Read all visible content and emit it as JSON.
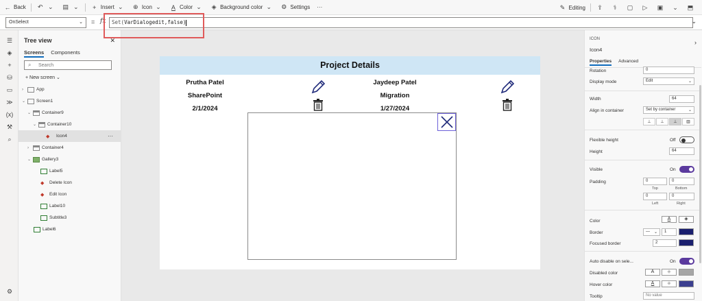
{
  "toolbar": {
    "back_label": "Back",
    "insert_label": "Insert",
    "icon_label": "Icon",
    "color_label": "Color",
    "background_label": "Background color",
    "settings_label": "Settings",
    "more_label": "···",
    "editing_label": "Editing"
  },
  "formula_bar": {
    "property": "OnSelect",
    "equals": "=",
    "fx": "fx",
    "formula_prefix": "Set(",
    "formula_var": "VarDialogedit,false)"
  },
  "tree": {
    "title": "Tree view",
    "tabs": [
      "Screens",
      "Components"
    ],
    "search_placeholder": "Search",
    "new_screen": "+ New screen",
    "nodes": [
      {
        "label": "App"
      },
      {
        "label": "Screen1"
      },
      {
        "label": "Container9"
      },
      {
        "label": "Container10"
      },
      {
        "label": "Icon4"
      },
      {
        "label": "Container4"
      },
      {
        "label": "Gallery3"
      },
      {
        "label": "Label5"
      },
      {
        "label": "Delete Icon"
      },
      {
        "label": "Edit Icon"
      },
      {
        "label": "Label10"
      },
      {
        "label": "Subtitle3"
      },
      {
        "label": "Label6"
      }
    ]
  },
  "canvas": {
    "title": "Project Details",
    "cards": [
      {
        "name": "Prutha Patel",
        "project": "SharePoint",
        "date": "2/1/2024"
      },
      {
        "name": "Jaydeep Patel",
        "project": "Migration",
        "date": "1/27/2024"
      }
    ]
  },
  "properties": {
    "type": "ICON",
    "name": "Icon4",
    "tabs": [
      "Properties",
      "Advanced"
    ],
    "rotation_label": "Rotation",
    "rotation_value": "0",
    "display_mode_label": "Display mode",
    "display_mode_value": "Edit",
    "width_label": "Width",
    "width_value": "64",
    "align_label": "Align in container",
    "align_value": "Set by container",
    "flexible_height_label": "Flexible height",
    "flexible_height_state": "Off",
    "height_label": "Height",
    "height_value": "64",
    "visible_label": "Visible",
    "visible_state": "On",
    "padding_label": "Padding",
    "padding_top": "0",
    "padding_bottom": "0",
    "padding_left": "0",
    "padding_right": "0",
    "pad_top_label": "Top",
    "pad_bottom_label": "Bottom",
    "pad_left_label": "Left",
    "pad_right_label": "Right",
    "color_label": "Color",
    "border_label": "Border",
    "border_value": "1",
    "focused_border_label": "Focused border",
    "focused_border_value": "2",
    "auto_disable_label": "Auto disable on sele...",
    "auto_disable_state": "On",
    "disabled_color_label": "Disabled color",
    "hover_color_label": "Hover color",
    "tooltip_label": "Tooltip",
    "tooltip_placeholder": "No value"
  },
  "colors": {
    "accent": "#0f6cbd",
    "toggle_on": "#5b3a9e",
    "icon_navy": "#1f2a7a",
    "header_blue": "#cfe6f5",
    "highlight_red": "#e05a5a"
  }
}
